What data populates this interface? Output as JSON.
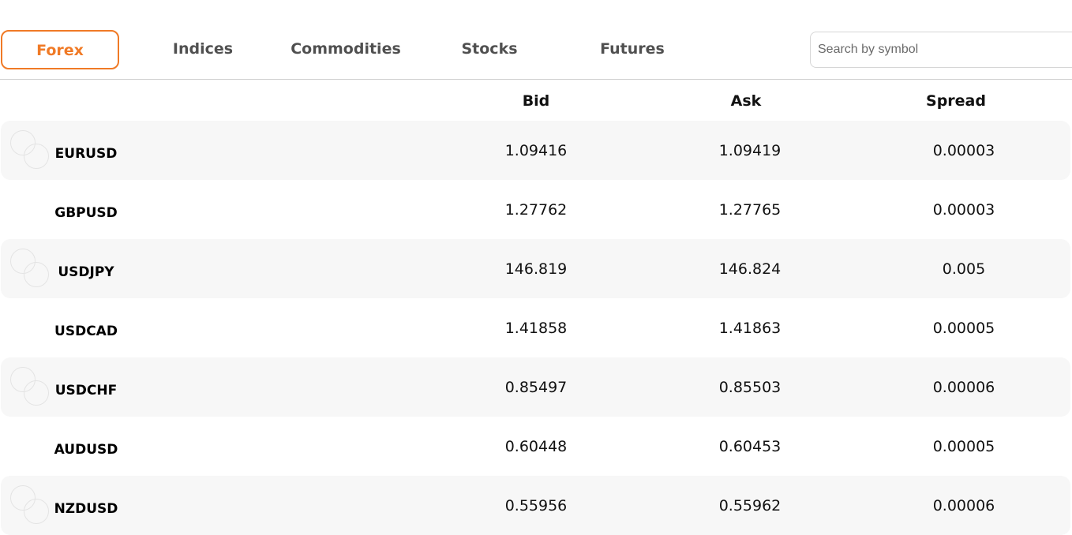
{
  "tabs": [
    {
      "id": "forex",
      "label": "Forex",
      "active": true
    },
    {
      "id": "indices",
      "label": "Indices",
      "active": false
    },
    {
      "id": "commodities",
      "label": "Commodities",
      "active": false
    },
    {
      "id": "stocks",
      "label": "Stocks",
      "active": false
    },
    {
      "id": "futures",
      "label": "Futures",
      "active": false
    }
  ],
  "search": {
    "placeholder": "Search by symbol",
    "value": ""
  },
  "table": {
    "columns": {
      "symbol": "",
      "bid": "Bid",
      "ask": "Ask",
      "spread": "Spread"
    },
    "rows": [
      {
        "symbol": "EURUSD",
        "bid": "1.09416",
        "ask": "1.09419",
        "spread": "0.00003",
        "icon": "currency-pair-icon"
      },
      {
        "symbol": "GBPUSD",
        "bid": "1.27762",
        "ask": "1.27765",
        "spread": "0.00003",
        "icon": "currency-pair-icon"
      },
      {
        "symbol": "USDJPY",
        "bid": "146.819",
        "ask": "146.824",
        "spread": "0.005",
        "icon": "currency-pair-icon"
      },
      {
        "symbol": "USDCAD",
        "bid": "1.41858",
        "ask": "1.41863",
        "spread": "0.00005",
        "icon": "currency-pair-icon"
      },
      {
        "symbol": "USDCHF",
        "bid": "0.85497",
        "ask": "0.85503",
        "spread": "0.00006",
        "icon": "currency-pair-icon"
      },
      {
        "symbol": "AUDUSD",
        "bid": "0.60448",
        "ask": "0.60453",
        "spread": "0.00005",
        "icon": "currency-pair-icon"
      },
      {
        "symbol": "NZDUSD",
        "bid": "0.55956",
        "ask": "0.55962",
        "spread": "0.00006",
        "icon": "currency-pair-icon"
      }
    ]
  },
  "colors": {
    "accent": "#f07a26",
    "tab_text": "#505050",
    "row_shade": "#f7f7f7",
    "divider": "#cfcfcf"
  }
}
